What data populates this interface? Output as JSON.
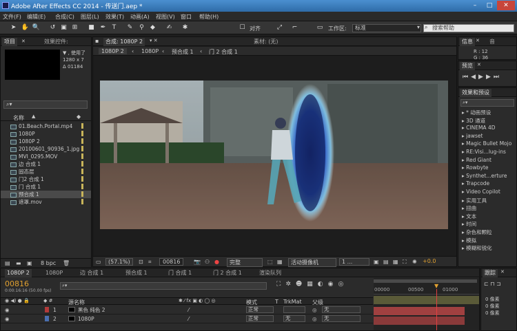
{
  "window": {
    "title": "Adobe After Effects CC 2014 - 传送门.aep *",
    "controls": [
      "–",
      "□",
      "✕"
    ]
  },
  "menu": [
    "文件(F)",
    "编辑(E)",
    "合成(C)",
    "图层(L)",
    "效果(T)",
    "动画(A)",
    "视图(V)",
    "窗口",
    "帮助(H)"
  ],
  "toolbar": {
    "align_label": "对齐",
    "workspace_label": "工作区:",
    "workspace_value": "标准",
    "search_placeholder": "搜索帮助"
  },
  "project_panel": {
    "tabs": [
      "项目",
      "效果控件:"
    ],
    "info_lines": [
      "▼ , 使用了",
      "1280 x 7",
      "Δ 01184"
    ],
    "search_value": "",
    "column_header": "名称",
    "items": [
      {
        "name": "01.Beach.Portal.mp4",
        "icon": "footage-icon",
        "color": "#c8b45a"
      },
      {
        "name": "1080P",
        "icon": "composition-icon",
        "color": "#c8b45a"
      },
      {
        "name": "1080P 2",
        "icon": "composition-icon",
        "color": "#c8b45a"
      },
      {
        "name": "20100601_90936_1.jpg",
        "icon": "image-icon",
        "color": "#c8b45a"
      },
      {
        "name": "MVI_0295.MOV",
        "icon": "footage-icon",
        "color": "#c8b45a"
      },
      {
        "name": "边 合成 1",
        "icon": "composition-icon",
        "color": "#c8b45a"
      },
      {
        "name": "固态层",
        "icon": "folder-icon",
        "color": "#c8b45a"
      },
      {
        "name": "门2 合成 1",
        "icon": "composition-icon",
        "color": "#c8b45a"
      },
      {
        "name": "门 合成 1",
        "icon": "composition-icon",
        "color": "#c8b45a"
      },
      {
        "name": "预合成 1",
        "icon": "composition-icon",
        "color": "#c8b45a"
      },
      {
        "name": "遮罩.mov",
        "icon": "footage-icon",
        "color": "#c8b45a"
      }
    ],
    "bpc": "8 bpc"
  },
  "composition_panel": {
    "tab": "合成: 1080P 2",
    "material_tab": "素材: (无)",
    "breadcrumb": [
      "1080P 2",
      "1080P",
      "预合成 1",
      "门 2 合成 1"
    ],
    "zoom": "(57.1%)",
    "timecode": "00816",
    "resolution": "完整",
    "camera": "活动摄像机",
    "views": "1 ...",
    "exposure": "+0.0"
  },
  "info_panel": {
    "tabs": [
      "信息",
      "音"
    ],
    "r": "R : 12",
    "g": "G : 36"
  },
  "preview_panel": {
    "tab": "预览"
  },
  "effects_panel": {
    "tab": "效果和预设",
    "search_value": "",
    "items": [
      "* 动画预设",
      "3D 通道",
      "CINEMA 4D",
      "jawset",
      "Magic Bullet Mojo",
      "RE:Visi...lug-ins",
      "Red Giant",
      "Rowbyte",
      "Synthet...erture",
      "Trapcode",
      "Video Copilot",
      "实用工具",
      "扭曲",
      "文本",
      "时间",
      "杂色和颗粒",
      "模拟",
      "模糊和锐化"
    ]
  },
  "timeline": {
    "tabs": [
      "1080P 2",
      "1080P",
      "边 合成 1",
      "预合成 1",
      "门 合成 1",
      "门 2 合成 1",
      "渲染队列"
    ],
    "current_time": "00816",
    "time_detail": "0:00:16:16 (50.00 fps)",
    "search_value": "",
    "headers": {
      "name": "源名称",
      "mode": "模式",
      "t": "T",
      "trkmat": "TrkMat",
      "parent": "父级"
    },
    "ruler": [
      "00000",
      "00500",
      "01000"
    ],
    "layers": [
      {
        "index": "1",
        "name": "黑色 纯色 2",
        "color": "#b23a3a",
        "mode": "正常",
        "trkmat": "",
        "parent": "无"
      },
      {
        "index": "2",
        "name": "1080P",
        "color": "#4a6fb0",
        "mode": "正常",
        "trkmat": "无",
        "parent": "无"
      }
    ]
  },
  "tracker_panel": {
    "tab": "跟踪",
    "items": [
      "0 像素",
      "0 像素",
      "0 像素"
    ]
  }
}
